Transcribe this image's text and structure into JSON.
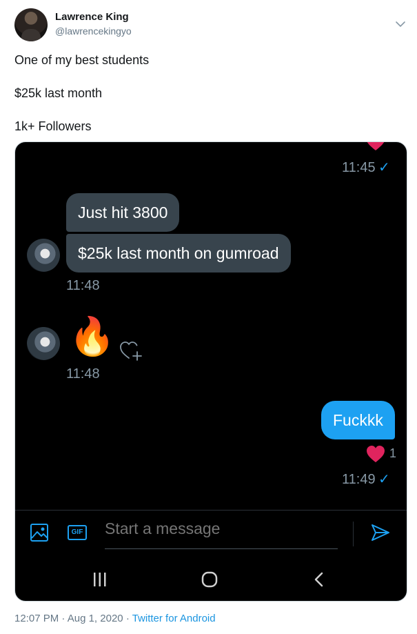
{
  "tweet": {
    "display_name": "Lawrence King",
    "handle": "@lawrencekingyo",
    "lines": [
      "One of my best students",
      "$25k last month",
      "1k+ Followers"
    ],
    "time": "12:07 PM",
    "date": "Aug 1, 2020",
    "separator": "·",
    "source": "Twitter for Android"
  },
  "dm": {
    "sent_time_1": "11:45",
    "bubble_1": "Just hit 3800",
    "bubble_2": "$25k last month on gumroad",
    "time_2": "11:48",
    "emoji_fire": "🔥",
    "time_3": "11:48",
    "outgoing_bubble": "Fuckkk",
    "reaction_count": "1",
    "sent_time_2": "11:49",
    "check": "✓",
    "gif_label": "GIF",
    "placeholder": "Start a message"
  },
  "colors": {
    "accent": "#1da1f2",
    "bubble_in": "#38444d",
    "heart": "#e0245e"
  },
  "icons": [
    "chevron-down-icon",
    "image-icon",
    "gif-icon",
    "send-icon",
    "add-reaction-icon",
    "heart-icon",
    "recent-apps-icon",
    "home-icon",
    "back-icon"
  ]
}
